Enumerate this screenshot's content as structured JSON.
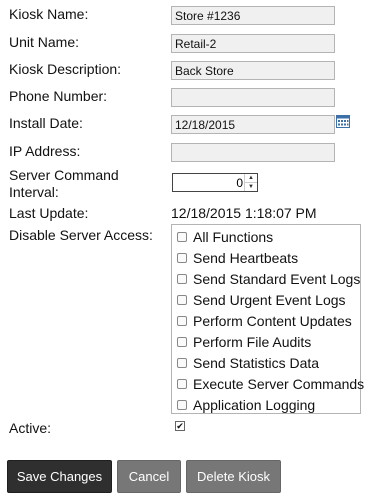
{
  "form": {
    "kiosk_name": {
      "label": "Kiosk Name:",
      "value": "Store #1236"
    },
    "unit_name": {
      "label": "Unit Name:",
      "value": "Retail-2"
    },
    "kiosk_description": {
      "label": "Kiosk Description:",
      "value": "Back Store"
    },
    "phone_number": {
      "label": "Phone Number:",
      "value": ""
    },
    "install_date": {
      "label": "Install Date:",
      "value": "12/18/2015",
      "icon": "calendar-icon"
    },
    "ip_address": {
      "label": "IP Address:",
      "value": ""
    },
    "server_command_interval": {
      "label_line1": "Server Command",
      "label_line2": "Interval:",
      "value": "0"
    },
    "last_update": {
      "label": "Last Update:",
      "value": "12/18/2015 1:18:07 PM"
    },
    "disable_server_access": {
      "label": "Disable Server Access:",
      "options": [
        {
          "label": "All Functions",
          "checked": false
        },
        {
          "label": "Send Heartbeats",
          "checked": false
        },
        {
          "label": "Send Standard Event Logs",
          "checked": false
        },
        {
          "label": "Send Urgent Event Logs",
          "checked": false
        },
        {
          "label": "Perform Content Updates",
          "checked": false
        },
        {
          "label": "Perform File Audits",
          "checked": false
        },
        {
          "label": "Send Statistics Data",
          "checked": false
        },
        {
          "label": "Execute Server Commands",
          "checked": false
        },
        {
          "label": "Application Logging",
          "checked": false
        }
      ]
    },
    "active": {
      "label": "Active:",
      "checked": true,
      "mark": "✔"
    }
  },
  "buttons": {
    "save": "Save Changes",
    "cancel": "Cancel",
    "delete": "Delete Kiosk"
  },
  "colors": {
    "dark_button": "#2f2f2f",
    "grey_button": "#777777",
    "input_background": "#f0f0f0"
  }
}
